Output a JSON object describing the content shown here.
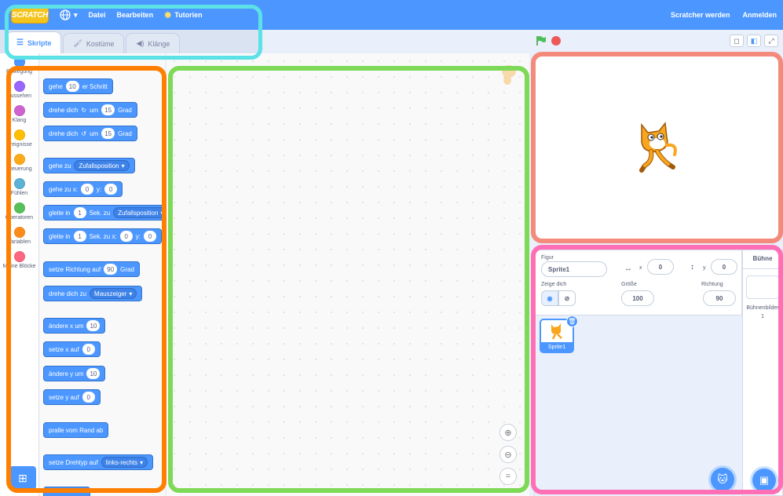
{
  "menubar": {
    "logo": "SCRATCH",
    "file": "Datei",
    "edit": "Bearbeiten",
    "tutorials": "Tutorien",
    "join": "Scratcher werden",
    "signin": "Anmelden"
  },
  "tabs": {
    "code": "Skripte",
    "costumes": "Kostüme",
    "sounds": "Klänge"
  },
  "categories": [
    "Bewegung",
    "Aussehen",
    "Klang",
    "Ereignisse",
    "Steuerung",
    "Fühlen",
    "Operatoren",
    "Variablen",
    "Meine Blöcke"
  ],
  "category_colors": [
    "#4c97ff",
    "#9966ff",
    "#cf63cf",
    "#ffbf00",
    "#ffab19",
    "#5cb1d6",
    "#59c059",
    "#ff8c1a",
    "#ff6680"
  ],
  "blocks": {
    "move": {
      "a": "gehe",
      "v": "10",
      "b": "er Schritt"
    },
    "turn_right": {
      "a": "drehe dich",
      "b": "um",
      "v": "15",
      "c": "Grad"
    },
    "turn_left": {
      "a": "drehe dich",
      "b": "um",
      "v": "15",
      "c": "Grad"
    },
    "goto": {
      "a": "gehe zu",
      "dd": "Zufallsposition"
    },
    "goto_xy": {
      "a": "gehe zu x:",
      "x": "0",
      "b": "y:",
      "y": "0"
    },
    "glide": {
      "a": "gleite in",
      "v": "1",
      "b": "Sek. zu",
      "dd": "Zufallsposition"
    },
    "glide_xy": {
      "a": "gleite in",
      "v": "1",
      "b": "Sek. zu x:",
      "x": "0",
      "c": "y:",
      "y": "0"
    },
    "point_dir": {
      "a": "setze Richtung auf",
      "v": "90",
      "b": "Grad"
    },
    "point_towards": {
      "a": "drehe dich zu",
      "dd": "Mauszeiger"
    },
    "change_x": {
      "a": "ändere x um",
      "v": "10"
    },
    "set_x": {
      "a": "setze x auf",
      "v": "0"
    },
    "change_y": {
      "a": "ändere y um",
      "v": "10"
    },
    "set_y": {
      "a": "setze y auf",
      "v": "0"
    },
    "bounce": {
      "a": "pralle vom Rand ab"
    },
    "rotation": {
      "a": "setze Drehtyp auf",
      "dd": "links-rechts"
    }
  },
  "sprite_info": {
    "sprite_label": "Figur",
    "sprite_name": "Sprite1",
    "x_label": "x",
    "x": "0",
    "y_label": "y",
    "y": "0",
    "show_label": "Zeige dich",
    "size_label": "Größe",
    "size": "100",
    "direction_label": "Richtung",
    "direction": "90"
  },
  "sprite_list": [
    {
      "name": "Sprite1"
    }
  ],
  "stage_panel": {
    "title": "Bühne",
    "backdrops_label": "Bühnenbilder",
    "backdrops_count": "1"
  },
  "icons": [
    "globe-icon",
    "lightbulb-icon",
    "green-flag-icon",
    "stop-icon",
    "small-stage-icon",
    "large-stage-icon",
    "fullscreen-icon",
    "zoom-in-icon",
    "zoom-out-icon",
    "zoom-reset-icon",
    "add-extension-icon",
    "choose-sprite-icon",
    "choose-backdrop-icon",
    "delete-icon",
    "eye-icon",
    "eye-hidden-icon",
    "cat-sprite-icon"
  ],
  "colors": {
    "menubar": "#4c97ff",
    "motion_block": "#4c97ff",
    "green_flag": "#4cbf56",
    "stop": "#ec5959"
  },
  "highlights": {
    "menu": "#5ce1e6",
    "blocks": "#ff7f00",
    "workspace": "#7ed957",
    "stage": "#f48a7c",
    "sprites": "#ff6fb5"
  }
}
